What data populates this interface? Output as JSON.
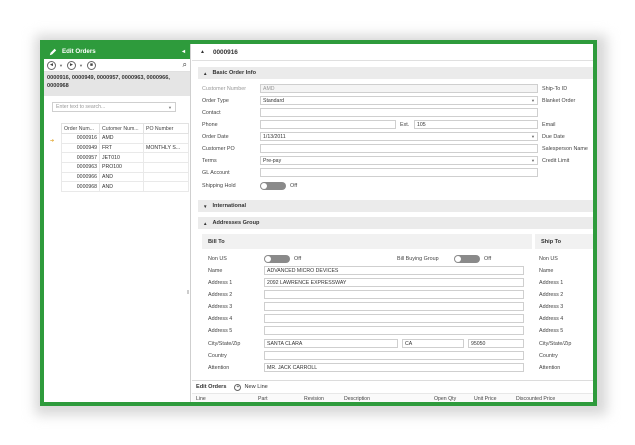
{
  "left_panel": {
    "title": "Edit Orders",
    "collapse_glyph": "◂",
    "toolbar": {
      "back_icon": "◄",
      "forward_icon": "►",
      "stop_icon": "■",
      "search_icon": "⌕"
    },
    "selected_orders": "0000916, 0000949, 0000957, 0000963, 0000966, 0000968",
    "search_placeholder": "Enter text to search...",
    "grid": {
      "columns": [
        "Order Num...",
        "Cutomer Num...",
        "PO Number"
      ],
      "rows": [
        {
          "order": "0000916",
          "customer": "AMD",
          "po": ""
        },
        {
          "order": "0000949",
          "customer": "FRT",
          "po": "MONTHLY S..."
        },
        {
          "order": "0000957",
          "customer": "JET010",
          "po": ""
        },
        {
          "order": "0000963",
          "customer": "PRO100",
          "po": ""
        },
        {
          "order": "0000966",
          "customer": "AND",
          "po": ""
        },
        {
          "order": "0000968",
          "customer": "AND",
          "po": ""
        }
      ]
    }
  },
  "document": {
    "title": "0000916",
    "sections": {
      "basic": "Basic Order Info",
      "international": "International",
      "addresses": "Addresses Group"
    },
    "basic": {
      "customer_number_label": "Customer Number",
      "customer_number_value": "AMD",
      "order_type_label": "Order Type",
      "order_type_value": "Standard",
      "contact_label": "Contact",
      "phone_label": "Phone",
      "ext_label": "Ext.",
      "ext_value": "105",
      "order_date_label": "Order Date",
      "order_date_value": "1/13/2011",
      "customer_po_label": "Customer PO",
      "terms_label": "Terms",
      "terms_value": "Pre-pay",
      "gl_account_label": "GL Account",
      "shipping_hold_label": "Shipping Hold",
      "shipping_hold_state": "Off",
      "right_labels": [
        "Ship-To ID",
        "Blanket Order",
        "",
        "Email",
        "Due Date",
        "Salesperson Name",
        "Credit Limit"
      ]
    },
    "bill_to": {
      "header": "Bill To",
      "non_us_label": "Non US",
      "non_us_state": "Off",
      "bill_buying_group_label": "Bill Buying Group",
      "bill_buying_group_state": "Off",
      "name_label": "Name",
      "name_value": "ADVANCED MICRO DEVICES",
      "address1_label": "Address 1",
      "address1_value": "2092 LAWRENCE EXPRESSWAY",
      "address2_label": "Address 2",
      "address3_label": "Address 3",
      "address4_label": "Address 4",
      "address5_label": "Address 5",
      "city_label": "City/State/Zip",
      "city_value": "SANTA CLARA",
      "state_value": "CA",
      "zip_value": "95050",
      "country_label": "Country",
      "attention_label": "Attention",
      "attention_value": "MR. JACK CARROLL"
    },
    "ship_to": {
      "header": "Ship To",
      "labels": [
        "Non US",
        "Name",
        "Address 1",
        "Address 2",
        "Address 3",
        "Address 4",
        "Address 5",
        "City/State/Zip",
        "Country",
        "Attention"
      ]
    },
    "lines": {
      "title": "Edit Orders",
      "new_line": "New Line",
      "columns": [
        "Line",
        "Part",
        "Revision",
        "Description",
        "Open Qty",
        "Unit Price",
        "Discounted Price"
      ]
    }
  },
  "colors": {
    "accent": "#2e9b3c",
    "section_bg": "#ebebeb",
    "toggle_off": "#8a8a8a"
  }
}
